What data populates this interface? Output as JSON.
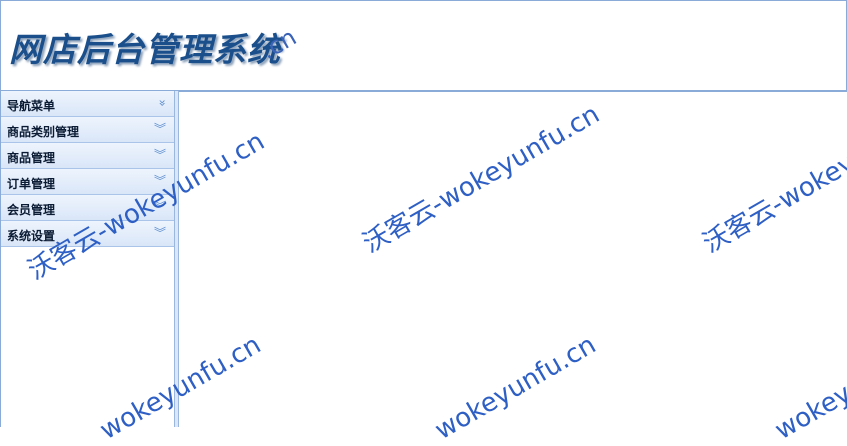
{
  "header": {
    "title": "网店后台管理系统",
    "watermark_tail": ".cn"
  },
  "sidebar": {
    "nav_header": "导航菜单",
    "items": [
      {
        "label": "商品类别管理"
      },
      {
        "label": "商品管理"
      },
      {
        "label": "订单管理"
      },
      {
        "label": "会员管理"
      },
      {
        "label": "系统设置"
      }
    ]
  },
  "watermark": {
    "text_cn": "沃客云-",
    "text_url": "wokeyunfu.cn",
    "full": "沃客云-wokeyunfu.cn"
  },
  "icons": {
    "collapse": "double-chevron-left-icon",
    "expand": "double-chevron-down-icon"
  },
  "colors": {
    "header_border": "#8aaad8",
    "title": "#1a4f8c",
    "menu_bg": "#d9e6f8",
    "watermark": "#2e5fc4"
  }
}
